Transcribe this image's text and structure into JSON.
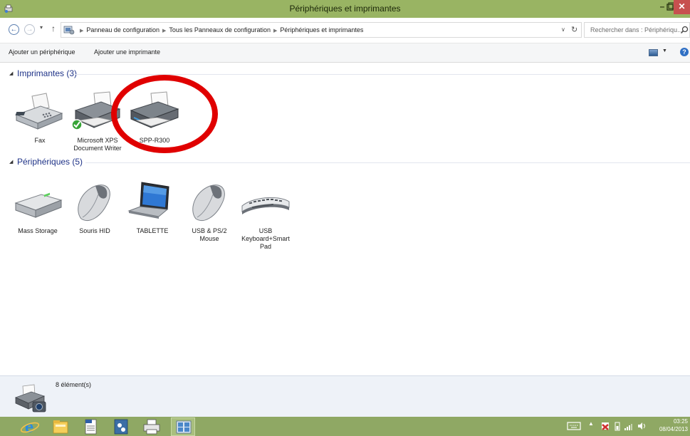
{
  "window": {
    "title": "Périphériques et imprimantes",
    "min_label": "–",
    "close_label": "✕"
  },
  "address": {
    "breadcrumbs": [
      "Panneau de configuration",
      "Tous les Panneaux de configuration",
      "Périphériques et imprimantes"
    ],
    "search_placeholder": "Rechercher dans : Périphériqu..."
  },
  "commands": {
    "add_device": "Ajouter un périphérique",
    "add_printer": "Ajouter une imprimante",
    "help": "?"
  },
  "groups": {
    "printers": {
      "title": "Imprimantes (3)",
      "items": [
        {
          "label": "Fax",
          "icon": "fax-icon"
        },
        {
          "label": "Microsoft XPS Document Writer",
          "icon": "printer-default-icon",
          "default": true
        },
        {
          "label": "SPP-R300",
          "icon": "printer-icon"
        }
      ]
    },
    "devices": {
      "title": "Périphériques (5)",
      "items": [
        {
          "label": "Mass Storage",
          "icon": "drive-icon"
        },
        {
          "label": "Souris HID",
          "icon": "mouse-icon"
        },
        {
          "label": "TABLETTE",
          "icon": "laptop-icon"
        },
        {
          "label": "USB & PS/2 Mouse",
          "icon": "mouse-icon"
        },
        {
          "label": "USB Keyboard+Smart Pad",
          "icon": "keyboard-icon"
        }
      ]
    }
  },
  "annotation": {
    "color": "#e00000",
    "target": "SPP-R300"
  },
  "details": {
    "count": "8 élément(s)"
  },
  "taskbar": {
    "apps": [
      "internet-explorer-icon",
      "file-explorer-icon",
      "pdf-document-icon",
      "devices-app-icon",
      "printer-app-icon",
      "control-panel-icon"
    ],
    "time": "03:25",
    "date": "08/04/2013"
  },
  "colors": {
    "titlebar": "#99b463",
    "taskbar": "#8fa864",
    "group_title": "#1e3287",
    "close": "#c7504f"
  }
}
